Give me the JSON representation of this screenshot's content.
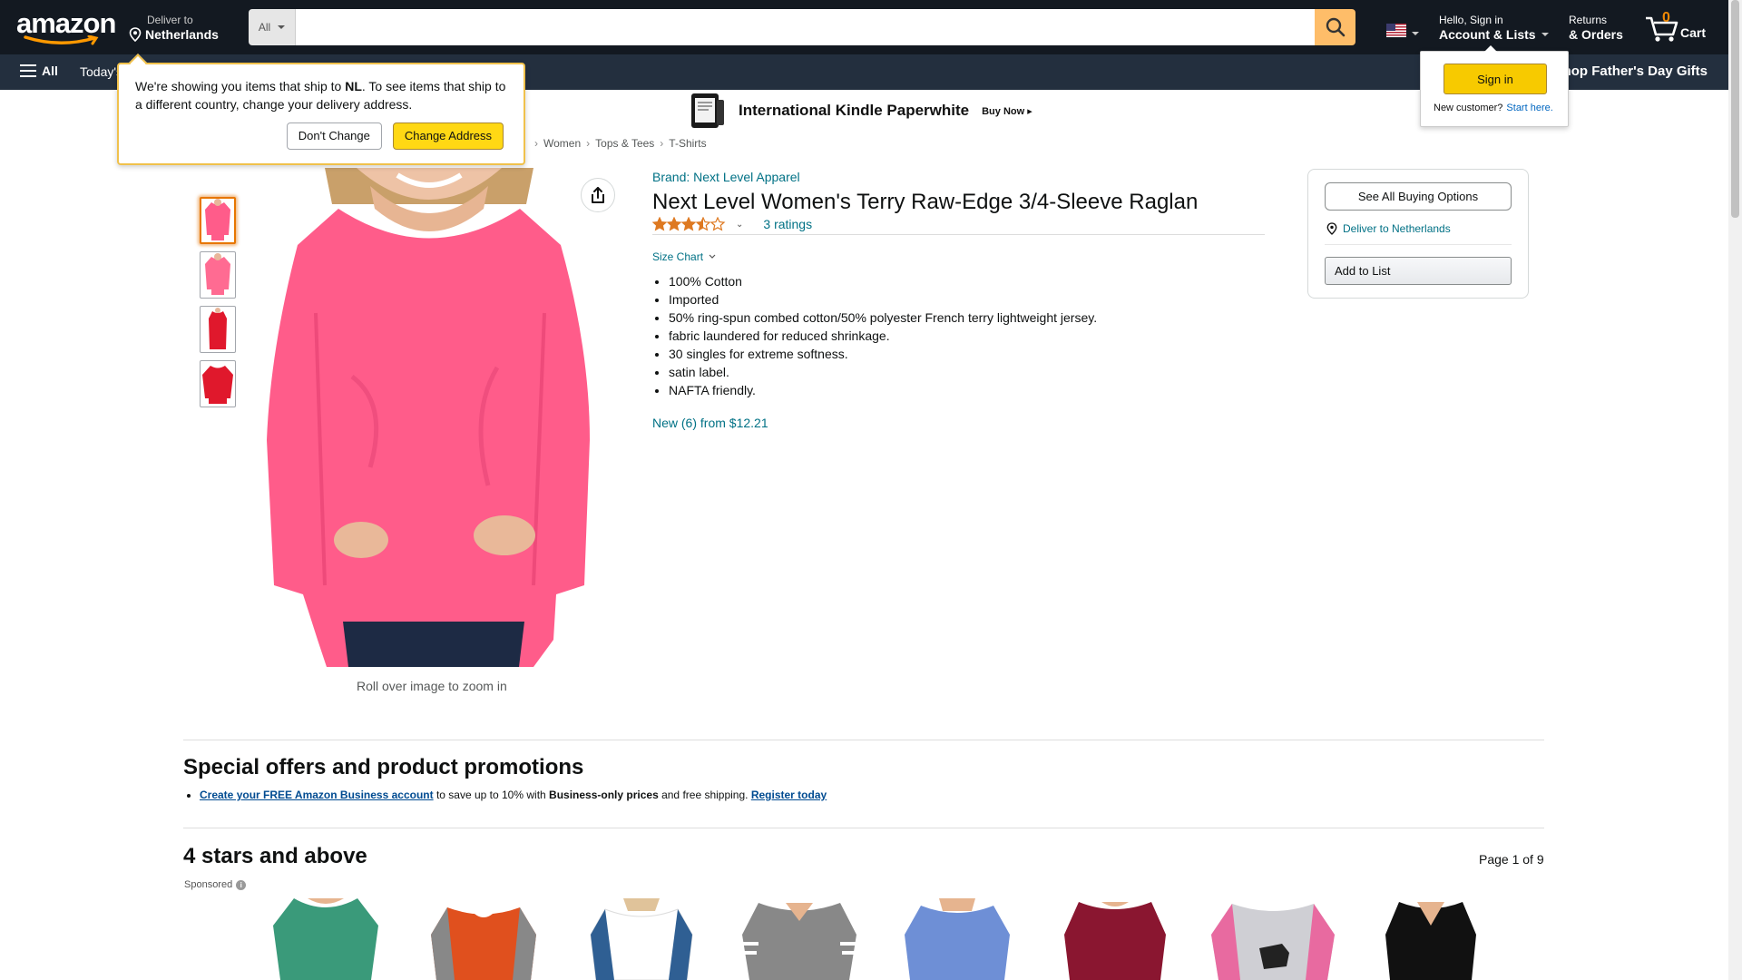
{
  "nav": {
    "logo": "amazon",
    "deliver_line1": "Deliver to",
    "deliver_line2": "Netherlands",
    "search_category": "All",
    "search_placeholder": "",
    "account_line1": "Hello, Sign in",
    "account_line2": "Account & Lists",
    "returns_line1": "Returns",
    "returns_line2": "& Orders",
    "cart_count": "0",
    "cart_label": "Cart",
    "all_label": "All",
    "today_label": "Today's",
    "fathers_day": "Shop Father's Day Gifts"
  },
  "popover": {
    "text_pre": "We're showing you items that ship to ",
    "text_country": "NL",
    "text_post": ". To see items that ship to a different country, change your delivery address.",
    "dont_change": "Don't Change",
    "change_address": "Change Address"
  },
  "signin": {
    "button": "Sign in",
    "new_customer": "New customer?",
    "start_here": "Start here."
  },
  "banner": {
    "title": "International Kindle Paperwhite",
    "cta": "Buy Now ▸"
  },
  "breadcrumb": [
    "Women",
    "Tops & Tees",
    "T-Shirts"
  ],
  "product": {
    "brand": "Brand: Next Level Apparel",
    "title": "Next Level Women's Terry Raw-Edge 3/4-Sleeve Raglan",
    "rating": 3.5,
    "ratings_count": "3 ratings",
    "size_chart": "Size Chart",
    "bullets": [
      "100% Cotton",
      "Imported",
      "50% ring-spun combed cotton/50% polyester French terry lightweight jersey.",
      "fabric laundered for reduced shrinkage.",
      "30 singles for extreme softness.",
      "satin label.",
      "NAFTA friendly."
    ],
    "new_from": "New (6) from $12.21",
    "zoom_hint": "Roll over image to zoom in"
  },
  "buybox": {
    "see_all": "See All Buying Options",
    "deliver": "Deliver to Netherlands",
    "add_to_list": "Add to List"
  },
  "offers": {
    "title": "Special offers and product promotions",
    "link1": "Create your FREE Amazon Business account",
    "mid1": " to save up to 10% with ",
    "bold": "Business-only prices",
    "mid2": " and free shipping. ",
    "link2": "Register today"
  },
  "similar": {
    "title": "4 stars and above",
    "page": "Page 1 of 9",
    "sponsored": "Sponsored"
  },
  "colors": {
    "nav_bg": "#131921",
    "subnav_bg": "#232f3e",
    "search_btn": "#febd69",
    "link": "#007185",
    "shirt_pink": "#ff5c8a",
    "shirt_red": "#e0182c"
  }
}
